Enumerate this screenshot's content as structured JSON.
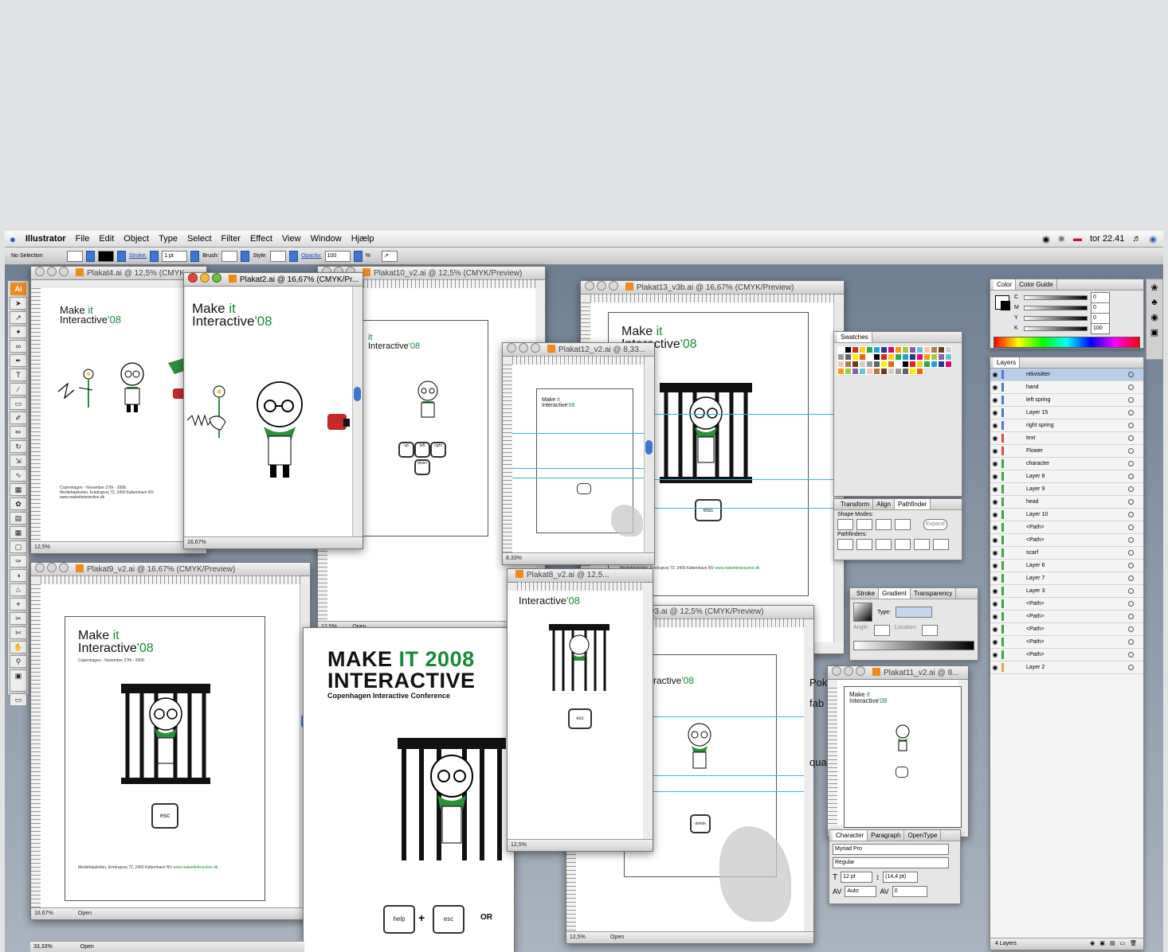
{
  "menubar": {
    "app": "Illustrator",
    "items": [
      "File",
      "Edit",
      "Object",
      "Type",
      "Select",
      "Filter",
      "Effect",
      "View",
      "Window",
      "Hjælp"
    ],
    "clock": "tor 22.41"
  },
  "controlbar": {
    "selection": "No Selection",
    "stroke_label": "Stroke:",
    "stroke_value": "1 pt",
    "brush_label": "Brush:",
    "style_label": "Style:",
    "opacity_label": "Opacity:",
    "opacity_value": "100",
    "percent": "%"
  },
  "toolbox": {
    "logo": "Ai"
  },
  "windows": {
    "plakat4": {
      "title": "Plakat4.ai @ 12,5% (CMYK",
      "zoom": "12,5%"
    },
    "plakat2": {
      "title": "Plakat2.ai @ 16,67% (CMYK/Pr...",
      "zoom": "16,67%"
    },
    "plakat10": {
      "title": "Plakat10_v2.ai @ 12,5% (CMYK/Preview)",
      "zoom": "12,5%",
      "status": "Open"
    },
    "plakat13": {
      "title": "Plakat13_v3b.ai @ 16,67% (CMYK/Preview)"
    },
    "plakat12": {
      "title": "Plakat12_v2.ai @ 8,33...",
      "zoom": "8,33%"
    },
    "plakat9": {
      "title": "Plakat9_v2.ai @ 16,67% (CMYK/Preview)",
      "zoom": "16,67%",
      "status": "Open"
    },
    "plakat8": {
      "title": "Plakat8_v2.ai @ 12,5...",
      "zoom": "12,5%"
    },
    "v3": {
      "title": "_v3.ai @ 12,5% (CMYK/Preview)",
      "zoom": "12,5%",
      "status": "Open"
    },
    "plakat11": {
      "title": "Plakat11_v2.ai @ 8..."
    },
    "bottom": {
      "zoom": "33,33%",
      "status": "Open"
    }
  },
  "poster": {
    "make": "Make",
    "it": "it",
    "interactive": "Interactive",
    "year": "'08",
    "big_make": "MAKE",
    "big_it": "IT",
    "big_year": "2008",
    "big_interactive": "INTERACTIVE",
    "big_subtitle": "Copenhagen Interactive Conference",
    "date": "Copenhagen - November 27th - 2008.",
    "venue": "Mediehøjskolen, Emdrupvej 72, 2400 København NV",
    "url": "www.makeitinteractive.dk",
    "key_esc": "esc",
    "key_help": "help",
    "key_delete": "delete",
    "plus": "+",
    "or": "OR",
    "key_up": "up",
    "key_down": "down",
    "key_left": "left",
    "key_right": "right"
  },
  "color_panel": {
    "tab1": "Color",
    "tab2": "Color Guide",
    "labels": [
      "C",
      "M",
      "Y",
      "K"
    ],
    "values": [
      "0",
      "0",
      "0",
      "100"
    ]
  },
  "swatches_panel": {
    "tab": "Swatches"
  },
  "pathfinder_panel": {
    "tabs": [
      "Transform",
      "Align",
      "Pathfinder"
    ],
    "shape_modes": "Shape Modes:",
    "expand": "Expand",
    "pathfinders": "Pathfinders:"
  },
  "stroke_panel": {
    "tabs": [
      "Stroke",
      "Gradient",
      "Transparency"
    ],
    "type": "Type:",
    "angle": "Angle:",
    "location": "Location:"
  },
  "character_panel": {
    "tabs": [
      "Character",
      "Paragraph",
      "OpenType"
    ],
    "font": "Myriad Pro",
    "style": "Regular",
    "size": "12 pt",
    "leading": "(14,4 pt)",
    "kerning": "Auto",
    "tracking": "0"
  },
  "layers_panel": {
    "tab": "Layers",
    "footer": "4 Layers",
    "rows": [
      {
        "name": "rekvisitter",
        "color": "#4a79d9",
        "sel": true
      },
      {
        "name": "hand",
        "color": "#4a79d9"
      },
      {
        "name": "left spring",
        "color": "#4a79d9"
      },
      {
        "name": "Layer 15",
        "color": "#4a79d9"
      },
      {
        "name": "right spring",
        "color": "#4a79d9"
      },
      {
        "name": "text",
        "color": "#d94a4a"
      },
      {
        "name": "Flower",
        "color": "#d94a4a"
      },
      {
        "name": "character",
        "color": "#3aa845"
      },
      {
        "name": "Layer 8",
        "color": "#3aa845"
      },
      {
        "name": "Layer 9",
        "color": "#3aa845"
      },
      {
        "name": "head",
        "color": "#3aa845"
      },
      {
        "name": "Layer 10",
        "color": "#3aa845"
      },
      {
        "name": "<Path>",
        "color": "#3aa845"
      },
      {
        "name": "<Path>",
        "color": "#3aa845"
      },
      {
        "name": "scarf",
        "color": "#3aa845"
      },
      {
        "name": "Layer 6",
        "color": "#3aa845"
      },
      {
        "name": "Layer 7",
        "color": "#3aa845"
      },
      {
        "name": "Layer 3",
        "color": "#3aa845"
      },
      {
        "name": "<Path>",
        "color": "#3aa845"
      },
      {
        "name": "<Path>",
        "color": "#3aa845"
      },
      {
        "name": "<Path>",
        "color": "#3aa845"
      },
      {
        "name": "<Path>",
        "color": "#3aa845"
      },
      {
        "name": "<Path>",
        "color": "#3aa845"
      },
      {
        "name": "Layer 2",
        "color": "#d9a84a"
      }
    ]
  },
  "partial_text": {
    "pok": "Pok",
    "fab": "fab",
    "qua": "qua"
  },
  "colors": {
    "accent_green": "#178a3b",
    "guide_cyan": "#35b9d6",
    "ai_orange": "#f08a1c"
  }
}
